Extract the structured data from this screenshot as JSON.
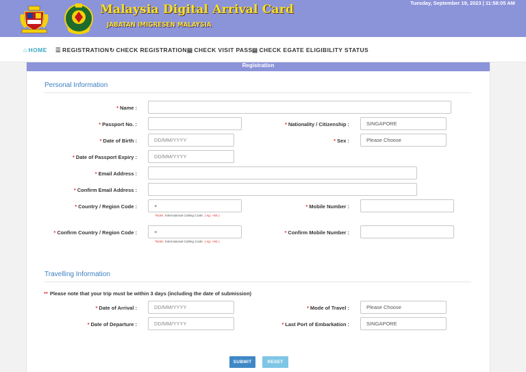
{
  "header": {
    "title": "Malaysia Digital Arrival Card",
    "subtitle": "JABATAN IMIGRESEN MALAYSIA",
    "datetime": "Tuesday, September 19, 2023 | 11:58:05 AM",
    "colors": {
      "bar": "#8b93d9",
      "title": "#f7e02a"
    }
  },
  "nav": {
    "home": "HOME",
    "registration": "REGISTRATION",
    "check_registration": "CHECK REGISTRATION",
    "check_visit_pass": "CHECK VISIT PASS",
    "check_egate": "CHECK EGATE ELIGIBILITY STATUS",
    "active_color": "#3ba8c6"
  },
  "panel": {
    "title": "Registration"
  },
  "personal": {
    "title": "Personal Information",
    "name_label": "Name :",
    "passport_label": "Passport No. :",
    "nationality_label": "Nationality / Citizenship :",
    "nationality_value": "SINGAPORE",
    "dob_label": "Date of Birth :",
    "dob_placeholder": "DD/MM/YYYY",
    "sex_label": "Sex :",
    "sex_value": "Please Choose",
    "passport_expiry_label": "Date of Passport Expiry :",
    "passport_expiry_placeholder": "DD/MM/YYYY",
    "email_label": "Email Address :",
    "confirm_email_label": "Confirm Email Address :",
    "country_code_label": "Country / Region Code :",
    "country_code_value": "+",
    "mobile_label": "Mobile Number :",
    "confirm_country_code_label": "Confirm Country / Region Code :",
    "confirm_country_code_value": "+",
    "confirm_mobile_label": "Confirm Mobile Number :",
    "note_prefix": "*Note:",
    "note_text": "International Calling Code.",
    "note_example": "( eg: +65 )"
  },
  "travel": {
    "title": "Travelling Information",
    "warning_mark": "**",
    "warning": "Please note that your trip must be within 3 days (including the date of submission)",
    "arrival_label": "Date of Arrival :",
    "arrival_placeholder": "DD/MM/YYYY",
    "mode_label": "Mode of Travel :",
    "mode_value": "Please Choose",
    "departure_label": "Date of Departure :",
    "departure_placeholder": "DD/MM/YYYY",
    "port_label": "Last Port of Embarkation :",
    "port_value": "SINGAPORE"
  },
  "required_mark": "*",
  "buttons": {
    "submit": "SUBMIT",
    "reset": "RESET"
  }
}
